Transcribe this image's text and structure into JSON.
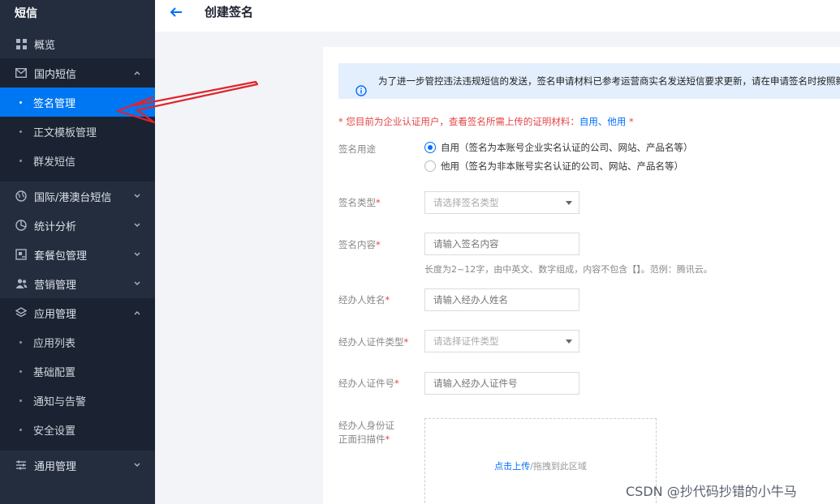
{
  "sidebar": {
    "title": "短信",
    "items": [
      {
        "label": "概览",
        "icon": "grid-icon"
      },
      {
        "label": "国内短信",
        "icon": "mail-icon",
        "expanded": true,
        "children": [
          "签名管理",
          "正文模板管理",
          "群发短信"
        ],
        "active_child": "签名管理"
      },
      {
        "label": "国际/港澳台短信",
        "icon": "globe-icon"
      },
      {
        "label": "统计分析",
        "icon": "pie-chart-icon"
      },
      {
        "label": "套餐包管理",
        "icon": "package-icon"
      },
      {
        "label": "营销管理",
        "icon": "users-icon"
      },
      {
        "label": "应用管理",
        "icon": "layers-icon",
        "expanded": true,
        "children": [
          "应用列表",
          "基础配置",
          "通知与告警",
          "安全设置"
        ]
      },
      {
        "label": "通用管理",
        "icon": "sliders-icon"
      }
    ]
  },
  "header": {
    "title": "创建签名",
    "back_icon": "arrow-left-icon"
  },
  "form": {
    "notice": "为了进一步管控违法违规短信的发送，签名申请材料已参考运营商实名发送短信要求更新，请在申请签名时按照新",
    "requirement_prefix": "* 您目前为企业认证用户，查看签名所需上传的证明材料：",
    "requirement_link1": "自用",
    "requirement_sep": "、",
    "requirement_link2": "他用",
    "requirement_suffix": " *",
    "usage_label": "签名用途",
    "usage_options": [
      "自用（签名为本账号企业实名认证的公司、网站、产品名等）",
      "他用（签名为非本账号实名认证的公司、网站、产品名等）"
    ],
    "usage_selected": 0,
    "type_label": "签名类型",
    "type_placeholder": "请选择签名类型",
    "content_label": "签名内容",
    "content_placeholder": "请输入签名内容",
    "content_hint": "长度为2~12字，由中英文、数字组成，内容不包含【】。范例：腾讯云。",
    "agent_name_label": "经办人姓名",
    "agent_name_placeholder": "请输入经办人姓名",
    "agent_idtype_label": "经办人证件类型",
    "agent_idtype_placeholder": "请选择证件类型",
    "agent_idno_label": "经办人证件号",
    "agent_idno_placeholder": "请输入经办人证件号",
    "agent_idscan_label_line1": "经办人身份证",
    "agent_idscan_label_line2": "正面扫描件",
    "upload_link": "点击上传",
    "upload_text": "/拖拽到此区域",
    "required_mark": "*"
  },
  "watermark": "CSDN @抄代码抄错的小牛马",
  "colors": {
    "sidebar_bg": "#232d3e",
    "active": "#0077f2",
    "link": "#006eff",
    "required": "#e54545",
    "annotation_arrow": "#e0242b"
  }
}
